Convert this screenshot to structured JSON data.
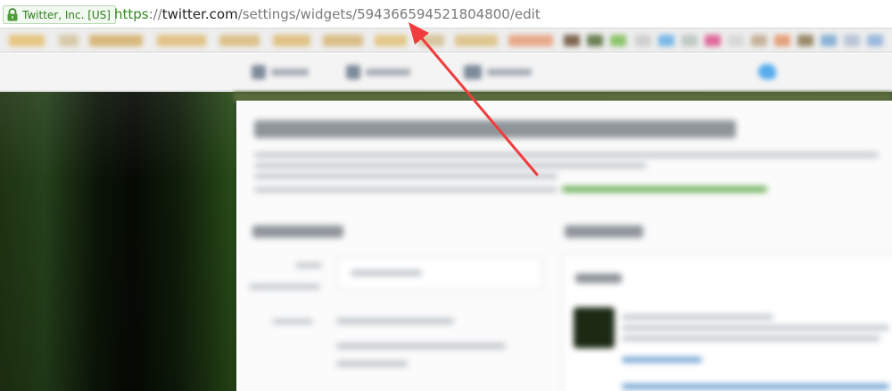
{
  "browser": {
    "ev_badge": {
      "icon": "lock-icon",
      "text": "Twitter, Inc. [US]",
      "color": "#2f8a1a"
    },
    "url": {
      "scheme": "https",
      "separator": "://",
      "host": "twitter.com",
      "path": "/settings/widgets/594366594521804800/edit"
    }
  },
  "annotation": {
    "icon": "arrow-icon",
    "color": "#f03c3c"
  },
  "colors": {
    "scheme_green": "#2f8a1a",
    "twitter_blue": "#55acee",
    "annotation_red": "#f03c3c"
  }
}
